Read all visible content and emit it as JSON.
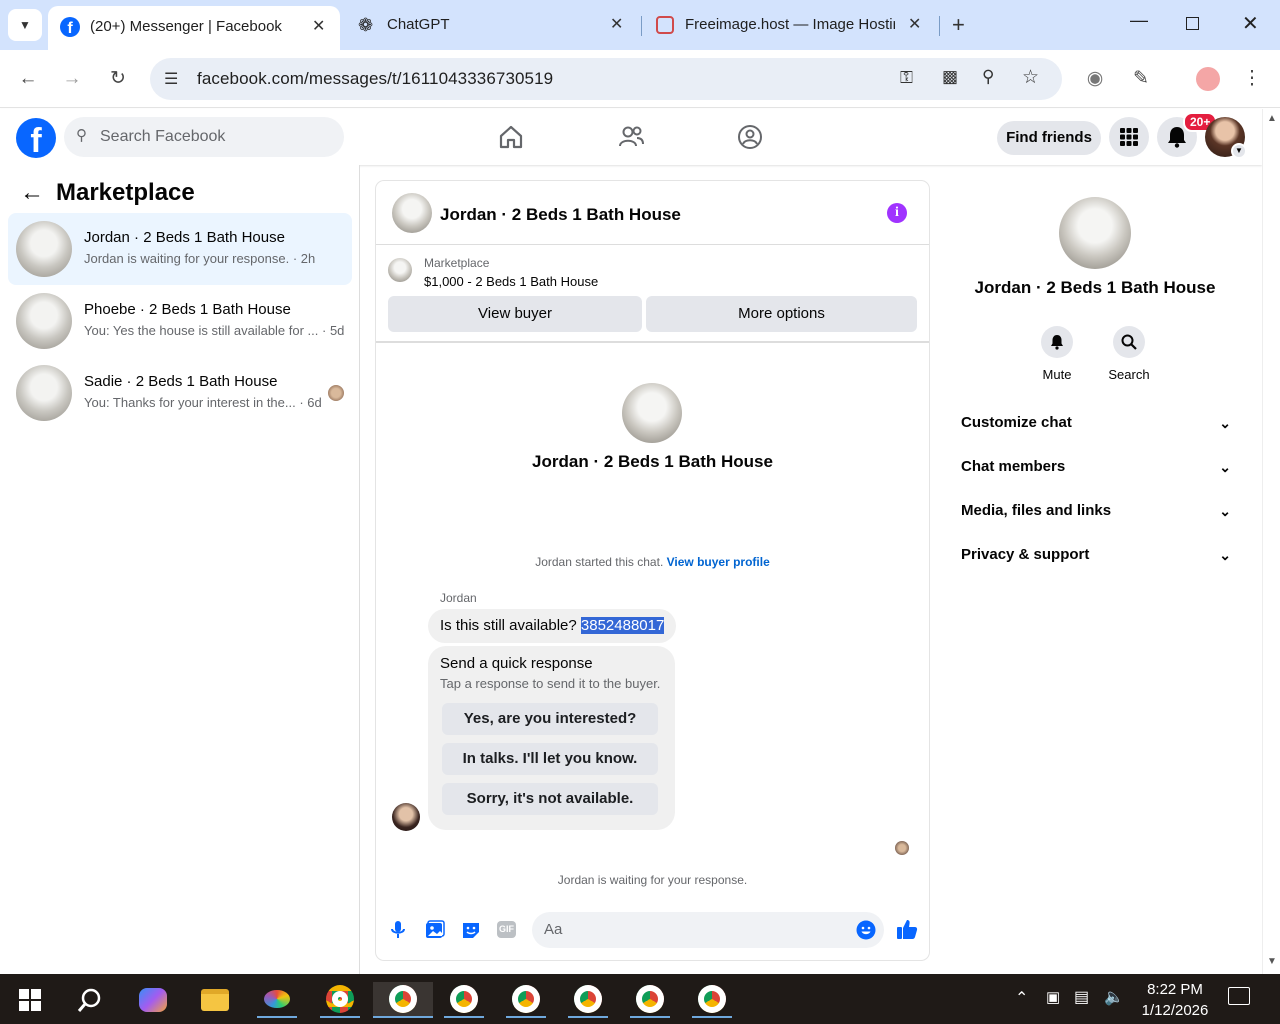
{
  "browser": {
    "tabs": [
      {
        "title": "(20+) Messenger | Facebook",
        "active": true
      },
      {
        "title": "ChatGPT",
        "active": false
      },
      {
        "title": "Freeimage.host — Image Hostin",
        "active": false
      }
    ],
    "url": "facebook.com/messages/t/1611043336730519"
  },
  "fb": {
    "search_placeholder": "Search Facebook",
    "find_friends": "Find friends",
    "notif_badge": "20+"
  },
  "left": {
    "title": "Marketplace",
    "conversations": [
      {
        "name": "Jordan · 2 Beds 1 Bath House",
        "snippet": "Jordan is waiting for your response. · 2h",
        "selected": true
      },
      {
        "name": "Phoebe · 2 Beds 1 Bath House",
        "snippet": "You: Yes the house is still available for ... · 5d",
        "selected": false
      },
      {
        "name": "Sadie · 2 Beds 1 Bath House",
        "snippet": "You: Thanks for your interest in the... · 6d",
        "selected": false
      }
    ]
  },
  "chat": {
    "header_title": "Jordan · 2 Beds 1 Bath House",
    "listing_label": "Marketplace",
    "listing_price": "$1,000 - 2 Beds 1 Bath House",
    "view_buyer": "View buyer",
    "more_options": "More options",
    "center_title": "Jordan · 2 Beds 1 Bath House",
    "started_text": "Jordan started this chat.",
    "view_buyer_profile": "View buyer profile",
    "sender": "Jordan",
    "message": "Is this still available?",
    "message_phone": "3852488017",
    "quick_title": "Send a quick response",
    "quick_sub": "Tap a response to send it to the buyer.",
    "quick_responses": [
      "Yes, are you interested?",
      "In talks. I'll let you know.",
      "Sorry, it's not available."
    ],
    "waiting": "Jordan is waiting for your response.",
    "composer_placeholder": "Aa"
  },
  "right": {
    "title": "Jordan · 2 Beds 1 Bath House",
    "mute": "Mute",
    "search": "Search",
    "sections": [
      "Customize chat",
      "Chat members",
      "Media, files and links",
      "Privacy & support"
    ]
  },
  "taskbar": {
    "time": "8:22 PM",
    "date": "1/12/2026"
  },
  "colors": {
    "fb_blue": "#0866ff",
    "messenger_purple": "#a033ff",
    "chrome_tabstrip": "#d3e3fd",
    "selected_conv": "#ebf5ff"
  }
}
